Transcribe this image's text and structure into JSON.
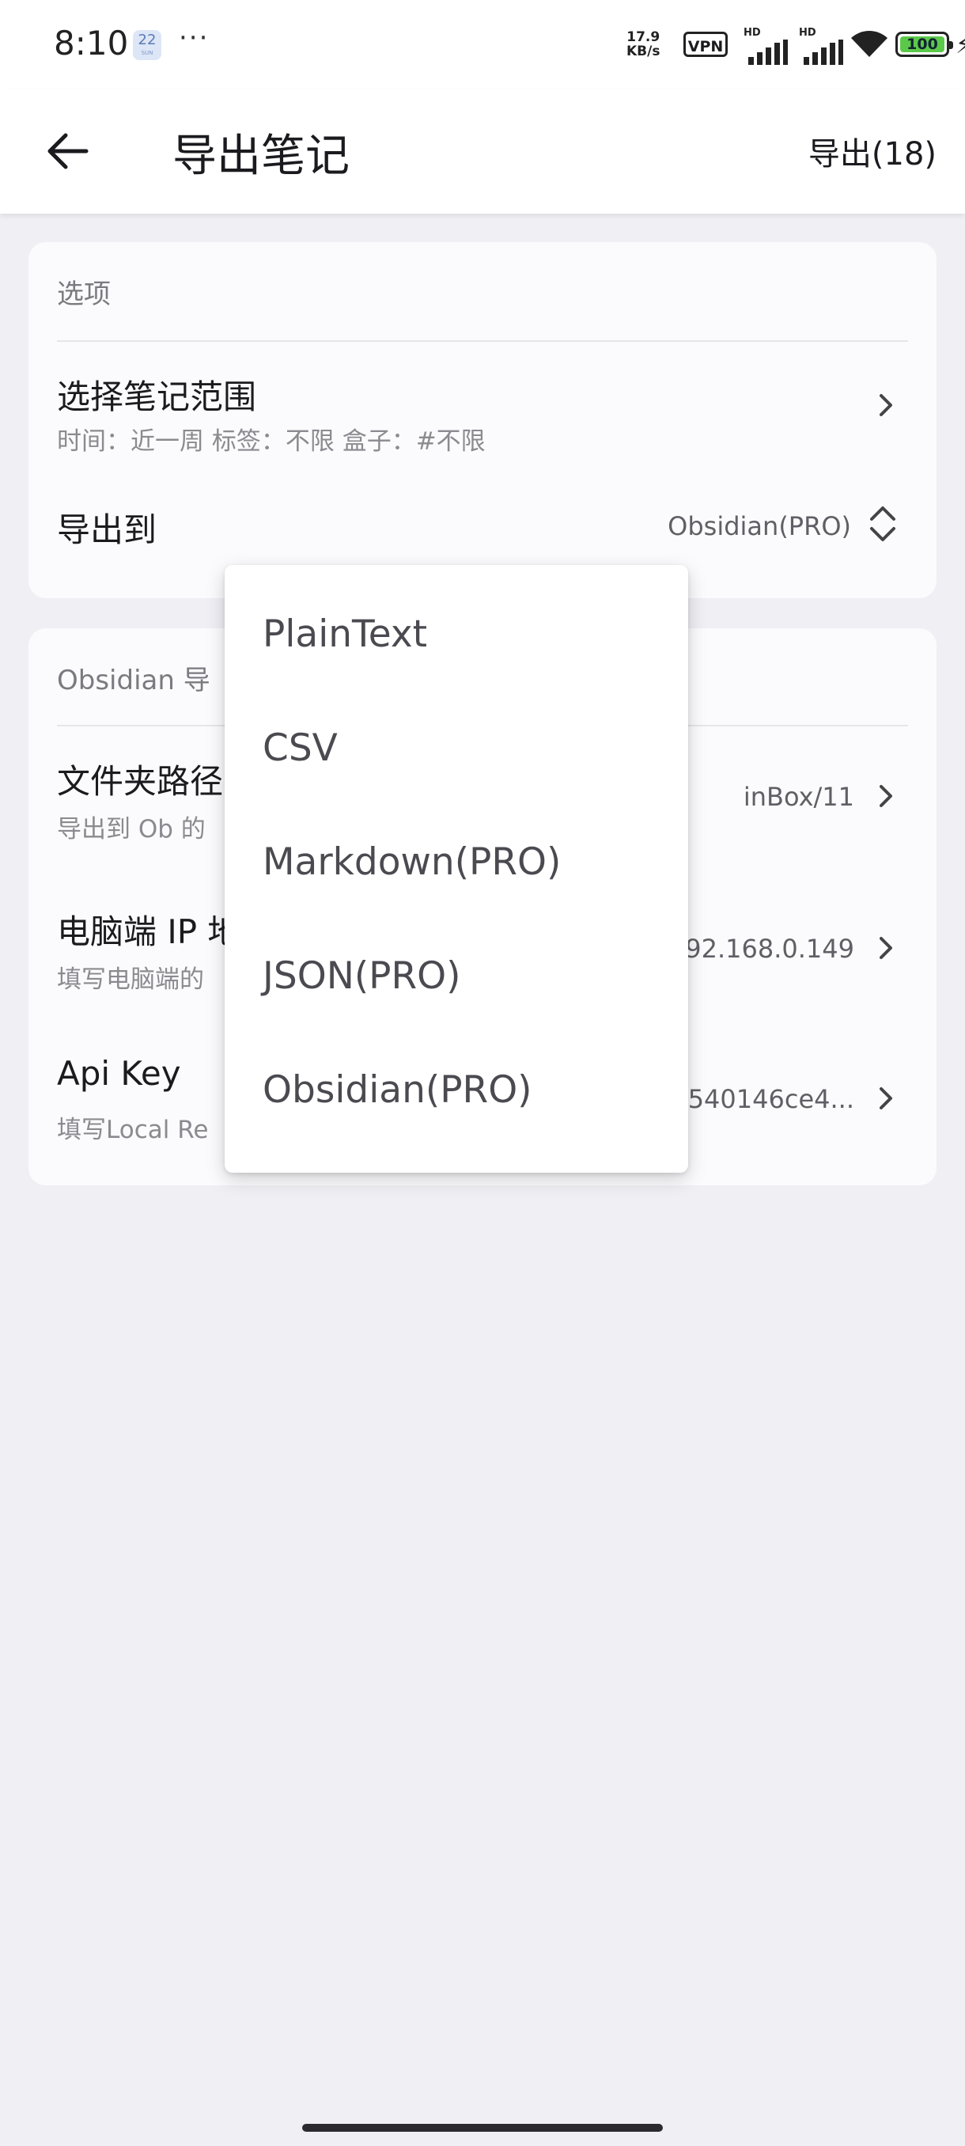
{
  "status_bar": {
    "time": "8:10",
    "calendar_day": "22",
    "calendar_weekday": "SUN",
    "more_dots": "···",
    "net_speed_value": "17.9",
    "net_speed_unit": "KB/s",
    "vpn_label": "VPN",
    "signal_label": "HD",
    "battery_level": "100",
    "battery_color": "#5cc84a"
  },
  "app_bar": {
    "title": "导出笔记",
    "export_action": "导出(18)"
  },
  "options_card": {
    "header": "选项",
    "range_title": "选择笔记范围",
    "range_subtitle": "时间：近一周 标签：不限 盒子：#不限",
    "export_to_label": "导出到",
    "export_to_value": "Obsidian(PRO)"
  },
  "obsidian_card": {
    "header": "Obsidian 导",
    "folder_title": "文件夹路径",
    "folder_subtitle": "导出到 Ob 的",
    "folder_value": "inBox/11",
    "ip_title": "电脑端 IP 地",
    "ip_subtitle": "填写电脑端的",
    "ip_value": "192.168.0.149",
    "apikey_title": "Api Key",
    "apikey_subtitle": "填写Local Re",
    "apikey_value": "540146ce4..."
  },
  "dropdown": {
    "options": [
      "PlainText",
      "CSV",
      "Markdown(PRO)",
      "JSON(PRO)",
      "Obsidian(PRO)"
    ]
  }
}
